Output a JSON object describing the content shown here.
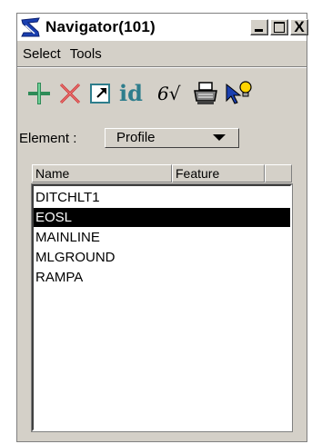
{
  "window": {
    "title": "Navigator(101)",
    "controls": [
      "minimize",
      "maximize",
      "close"
    ],
    "close_glyph": "X"
  },
  "menu": {
    "items": [
      {
        "label": "Select"
      },
      {
        "label": "Tools"
      }
    ]
  },
  "toolbar": {
    "tools": [
      {
        "icon": "add-plus-icon",
        "color": "#2e8b57"
      },
      {
        "icon": "delete-x-icon",
        "color": "#cc3333"
      },
      {
        "icon": "window-area-icon"
      },
      {
        "icon": "id-icon",
        "label": "id",
        "color": "#2e7d8c"
      },
      {
        "icon": "review-glasses-icon",
        "label": "6√"
      },
      {
        "icon": "print-icon"
      },
      {
        "icon": "pointer-bulb-icon"
      }
    ]
  },
  "element": {
    "label": "Element :",
    "selected": "Profile"
  },
  "list": {
    "columns": [
      "Name",
      "Feature",
      ""
    ],
    "rows": [
      {
        "name": "DITCHLT1",
        "feature": "",
        "selected": false
      },
      {
        "name": "EOSL",
        "feature": "",
        "selected": true
      },
      {
        "name": "MAINLINE",
        "feature": "",
        "selected": false
      },
      {
        "name": "MLGROUND",
        "feature": "",
        "selected": false
      },
      {
        "name": "RAMPA",
        "feature": "",
        "selected": false
      }
    ]
  },
  "colors": {
    "window_bg": "#d4d0c8",
    "selection_bg": "#000000",
    "selection_fg": "#ffffff"
  }
}
